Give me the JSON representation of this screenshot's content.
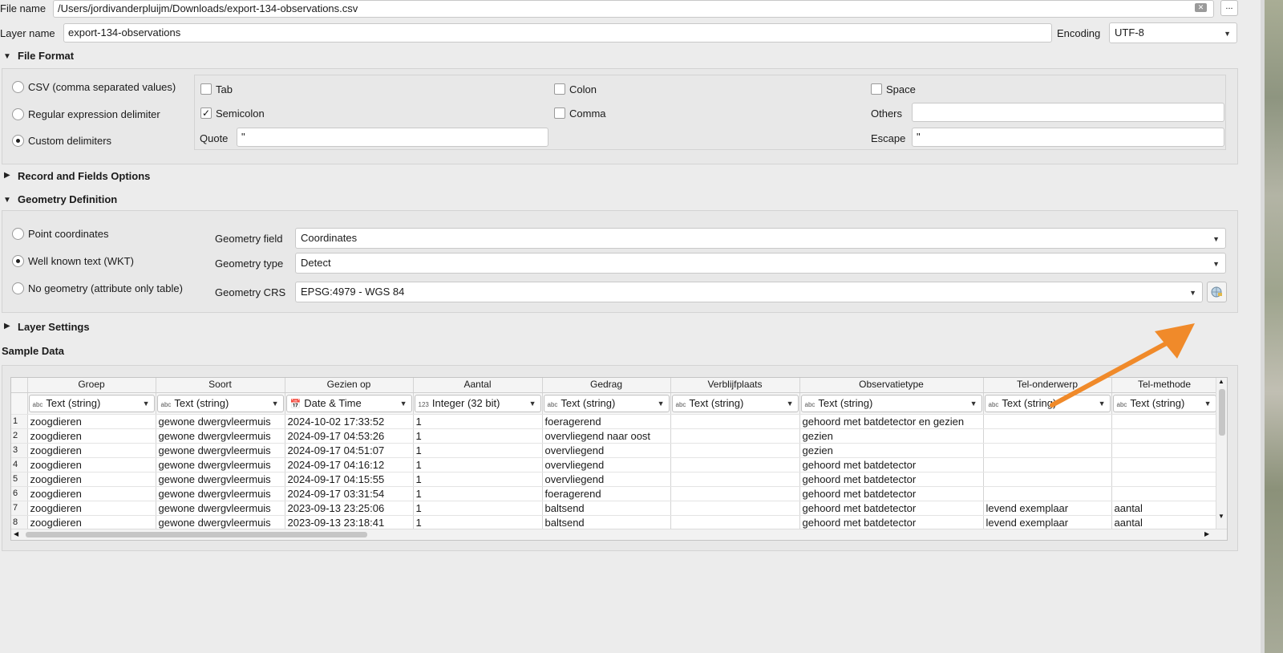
{
  "file_name": {
    "label": "File name",
    "value": "/Users/jordivanderpluijm/Downloads/export-134-observations.csv",
    "browse_label": "..."
  },
  "layer_name": {
    "label": "Layer name",
    "value": "export-134-observations"
  },
  "encoding": {
    "label": "Encoding",
    "value": "UTF-8"
  },
  "file_format": {
    "title": "File Format",
    "options": [
      "CSV (comma separated values)",
      "Regular expression delimiter",
      "Custom delimiters"
    ],
    "selected_option": "Custom delimiters",
    "delimiters": {
      "tab": {
        "label": "Tab",
        "checked": false
      },
      "colon": {
        "label": "Colon",
        "checked": false
      },
      "space": {
        "label": "Space",
        "checked": false
      },
      "semicolon": {
        "label": "Semicolon",
        "checked": true
      },
      "comma": {
        "label": "Comma",
        "checked": false
      }
    },
    "others_label": "Others",
    "others_value": "",
    "quote_label": "Quote",
    "quote_value": "\"",
    "escape_label": "Escape",
    "escape_value": "\""
  },
  "record_fields": {
    "title": "Record and Fields Options"
  },
  "geometry": {
    "title": "Geometry Definition",
    "options": [
      "Point coordinates",
      "Well known text (WKT)",
      "No geometry (attribute only table)"
    ],
    "selected_option": "Well known text (WKT)",
    "field_label": "Geometry field",
    "field_value": "Coordinates",
    "type_label": "Geometry type",
    "type_value": "Detect",
    "crs_label": "Geometry CRS",
    "crs_value": "EPSG:4979 - WGS 84"
  },
  "layer_settings": {
    "title": "Layer Settings"
  },
  "sample_data": {
    "title": "Sample Data",
    "columns": [
      "Groep",
      "Soort",
      "Gezien op",
      "Aantal",
      "Gedrag",
      "Verblijfplaats",
      "Observatietype",
      "Tel-onderwerp",
      "Tel-methode"
    ],
    "types": [
      {
        "icon": "abc",
        "label": "Text (string)"
      },
      {
        "icon": "abc",
        "label": "Text (string)"
      },
      {
        "icon": "calendar-icon",
        "label": "Date & Time"
      },
      {
        "icon": "123",
        "label": "Integer (32 bit)"
      },
      {
        "icon": "abc",
        "label": "Text (string)"
      },
      {
        "icon": "abc",
        "label": "Text (string)"
      },
      {
        "icon": "abc",
        "label": "Text (string)"
      },
      {
        "icon": "abc",
        "label": "Text (string)"
      },
      {
        "icon": "abc",
        "label": "Text (string)"
      }
    ],
    "rows": [
      [
        "1",
        "zoogdieren",
        "gewone dwergvleermuis",
        "2024-10-02 17:33:52",
        "1",
        "foeragerend",
        "",
        "gehoord met batdetector en gezien",
        "",
        ""
      ],
      [
        "2",
        "zoogdieren",
        "gewone dwergvleermuis",
        "2024-09-17 04:53:26",
        "1",
        "overvliegend naar oost",
        "",
        "gezien",
        "",
        ""
      ],
      [
        "3",
        "zoogdieren",
        "gewone dwergvleermuis",
        "2024-09-17 04:51:07",
        "1",
        "overvliegend",
        "",
        "gezien",
        "",
        ""
      ],
      [
        "4",
        "zoogdieren",
        "gewone dwergvleermuis",
        "2024-09-17 04:16:12",
        "1",
        "overvliegend",
        "",
        "gehoord met batdetector",
        "",
        ""
      ],
      [
        "5",
        "zoogdieren",
        "gewone dwergvleermuis",
        "2024-09-17 04:15:55",
        "1",
        "overvliegend",
        "",
        "gehoord met batdetector",
        "",
        ""
      ],
      [
        "6",
        "zoogdieren",
        "gewone dwergvleermuis",
        "2024-09-17 03:31:54",
        "1",
        "foeragerend",
        "",
        "gehoord met batdetector",
        "",
        ""
      ],
      [
        "7",
        "zoogdieren",
        "gewone dwergvleermuis",
        "2023-09-13 23:25:06",
        "1",
        "baltsend",
        "",
        "gehoord met batdetector",
        "levend exemplaar",
        "aantal"
      ],
      [
        "8",
        "zoogdieren",
        "gewone dwergvleermuis",
        "2023-09-13 23:18:41",
        "1",
        "baltsend",
        "",
        "gehoord met batdetector",
        "levend exemplaar",
        "aantal"
      ]
    ]
  },
  "colors": {
    "annotation_arrow": "#f08a2a",
    "panel_bg": "#ececec"
  }
}
